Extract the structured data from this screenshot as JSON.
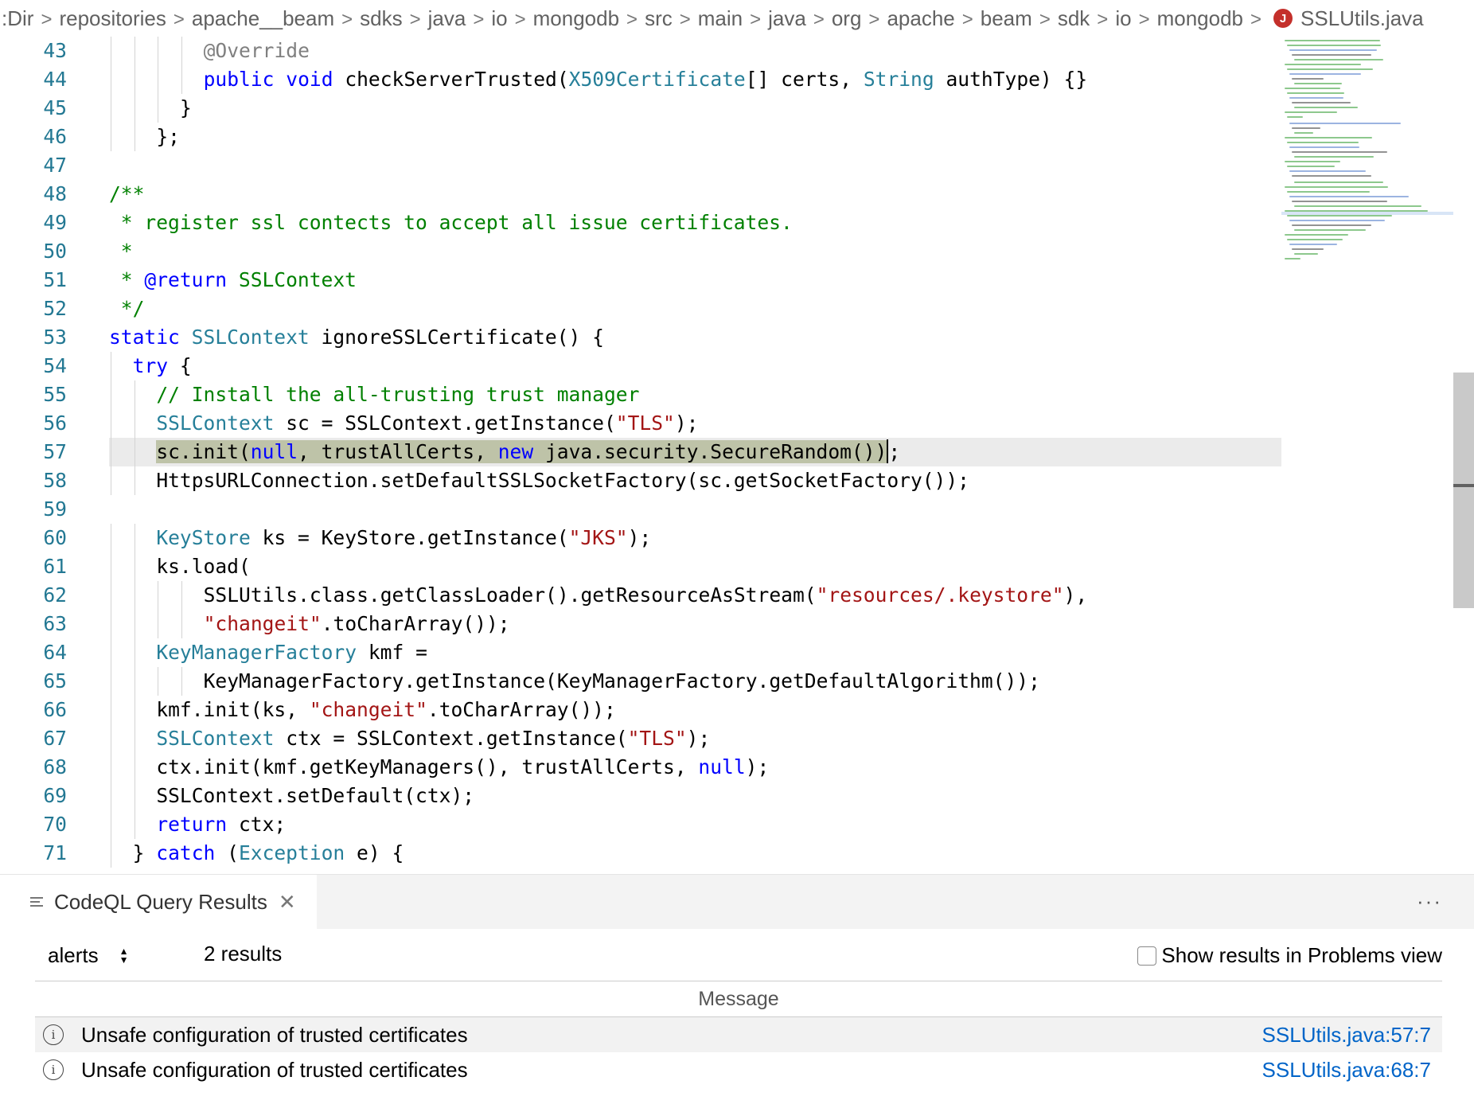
{
  "breadcrumb": {
    "items": [
      ":Dir",
      "repositories",
      "apache__beam",
      "sdks",
      "java",
      "io",
      "mongodb",
      "src",
      "main",
      "java",
      "org",
      "apache",
      "beam",
      "sdk",
      "io",
      "mongodb"
    ],
    "file_badge": "J",
    "file_name": "SSLUtils.java",
    "separator": ">"
  },
  "editor": {
    "lines": [
      {
        "n": "43",
        "i": 4,
        "t": [
          [
            "@Override",
            "an"
          ]
        ]
      },
      {
        "n": "44",
        "i": 4,
        "t": [
          [
            "public void ",
            "kw"
          ],
          [
            "checkServerTrusted(",
            "pl"
          ],
          [
            "X509Certificate",
            "ty"
          ],
          [
            "[] certs, ",
            "pl"
          ],
          [
            "String",
            "ty"
          ],
          [
            " authType) {}",
            "pl"
          ]
        ]
      },
      {
        "n": "45",
        "i": 3,
        "t": [
          [
            "}",
            "pl"
          ]
        ]
      },
      {
        "n": "46",
        "i": 2,
        "t": [
          [
            "};",
            "pl"
          ]
        ]
      },
      {
        "n": "47",
        "i": 0,
        "t": []
      },
      {
        "n": "48",
        "i": 0,
        "t": [
          [
            "/**",
            "cm"
          ]
        ]
      },
      {
        "n": "49",
        "i": 0,
        "t": [
          [
            " * register ssl contects to accept all issue certificates.",
            "cm"
          ]
        ]
      },
      {
        "n": "50",
        "i": 0,
        "t": [
          [
            " *",
            "cm"
          ]
        ]
      },
      {
        "n": "51",
        "i": 0,
        "t": [
          [
            " * ",
            "cm"
          ],
          [
            "@return",
            "kw"
          ],
          [
            " SSLContext",
            "cm"
          ]
        ]
      },
      {
        "n": "52",
        "i": 0,
        "t": [
          [
            " */",
            "cm"
          ]
        ]
      },
      {
        "n": "53",
        "i": 0,
        "t": [
          [
            "static ",
            "kw"
          ],
          [
            "SSLContext",
            "ty"
          ],
          [
            " ignoreSSLCertificate() {",
            "pl"
          ]
        ]
      },
      {
        "n": "54",
        "i": 1,
        "t": [
          [
            "try",
            "kw"
          ],
          [
            " {",
            "pl"
          ]
        ]
      },
      {
        "n": "55",
        "i": 2,
        "t": [
          [
            "// Install the all-trusting trust manager",
            "cm"
          ]
        ]
      },
      {
        "n": "56",
        "i": 2,
        "t": [
          [
            "SSLContext",
            "ty"
          ],
          [
            " sc = SSLContext.getInstance(",
            "pl"
          ],
          [
            "\"TLS\"",
            "st"
          ],
          [
            ");",
            "pl"
          ]
        ]
      },
      {
        "n": "57",
        "i": 2,
        "current": true,
        "t": [
          [
            "sc.init(",
            "sel"
          ],
          [
            "null",
            "kw sel"
          ],
          [
            ", trustAllCerts, ",
            "sel"
          ],
          [
            "new",
            "kw sel"
          ],
          [
            " java.security.SecureRandom())",
            "sel"
          ],
          [
            "|",
            "cursor"
          ],
          [
            ";",
            "pl"
          ]
        ]
      },
      {
        "n": "58",
        "i": 2,
        "t": [
          [
            "HttpsURLConnection.setDefaultSSLSocketFactory(sc.getSocketFactory());",
            "pl"
          ]
        ]
      },
      {
        "n": "59",
        "i": 0,
        "t": []
      },
      {
        "n": "60",
        "i": 2,
        "t": [
          [
            "KeyStore",
            "ty"
          ],
          [
            " ks = KeyStore.getInstance(",
            "pl"
          ],
          [
            "\"JKS\"",
            "st"
          ],
          [
            ");",
            "pl"
          ]
        ]
      },
      {
        "n": "61",
        "i": 2,
        "t": [
          [
            "ks.load(",
            "pl"
          ]
        ]
      },
      {
        "n": "62",
        "i": 4,
        "t": [
          [
            "SSLUtils.class.getClassLoader().getResourceAsStream(",
            "pl"
          ],
          [
            "\"resources/.keystore\"",
            "st"
          ],
          [
            "),",
            "pl"
          ]
        ]
      },
      {
        "n": "63",
        "i": 4,
        "t": [
          [
            "\"changeit\"",
            "st"
          ],
          [
            ".toCharArray());",
            "pl"
          ]
        ]
      },
      {
        "n": "64",
        "i": 2,
        "t": [
          [
            "KeyManagerFactory",
            "ty"
          ],
          [
            " kmf =",
            "pl"
          ]
        ]
      },
      {
        "n": "65",
        "i": 4,
        "t": [
          [
            "KeyManagerFactory.getInstance(KeyManagerFactory.getDefaultAlgorithm());",
            "pl"
          ]
        ]
      },
      {
        "n": "66",
        "i": 2,
        "t": [
          [
            "kmf.init(ks, ",
            "pl"
          ],
          [
            "\"changeit\"",
            "st"
          ],
          [
            ".toCharArray());",
            "pl"
          ]
        ]
      },
      {
        "n": "67",
        "i": 2,
        "t": [
          [
            "SSLContext",
            "ty"
          ],
          [
            " ctx = SSLContext.getInstance(",
            "pl"
          ],
          [
            "\"TLS\"",
            "st"
          ],
          [
            ");",
            "pl"
          ]
        ]
      },
      {
        "n": "68",
        "i": 2,
        "t": [
          [
            "ctx.init(kmf.getKeyManagers(), trustAllCerts, ",
            "pl"
          ],
          [
            "null",
            "kw"
          ],
          [
            ");",
            "pl"
          ]
        ]
      },
      {
        "n": "69",
        "i": 2,
        "t": [
          [
            "SSLContext.setDefault(ctx);",
            "pl"
          ]
        ]
      },
      {
        "n": "70",
        "i": 2,
        "t": [
          [
            "return",
            "kw"
          ],
          [
            " ctx;",
            "pl"
          ]
        ]
      },
      {
        "n": "71",
        "i": 1,
        "t": [
          [
            "} ",
            "pl"
          ],
          [
            "catch",
            "kw"
          ],
          [
            " (",
            "pl"
          ],
          [
            "Exception",
            "ty"
          ],
          [
            " e) {",
            "pl"
          ]
        ]
      }
    ]
  },
  "panel": {
    "tab_label": "CodeQL Query Results",
    "tab_close": "✕",
    "more": "···",
    "select_value": "alerts",
    "result_count": "2 results",
    "toggle_label": "Show results in Problems view",
    "column_header": "Message",
    "rows": [
      {
        "message": "Unsafe configuration of trusted certificates",
        "location": "SSLUtils.java:57:7"
      },
      {
        "message": "Unsafe configuration of trusted certificates",
        "location": "SSLUtils.java:68:7"
      }
    ]
  },
  "icons": {
    "file_badge": "java-file-icon",
    "tab": "list-icon",
    "row": "info-icon",
    "select": "updown-arrow-icon"
  },
  "colors": {
    "keyword": "#0000ff",
    "type": "#267f99",
    "comment": "#008000",
    "string": "#a31515",
    "line_number": "#237893",
    "link": "#0064c8",
    "file_badge": "#c4302b"
  }
}
